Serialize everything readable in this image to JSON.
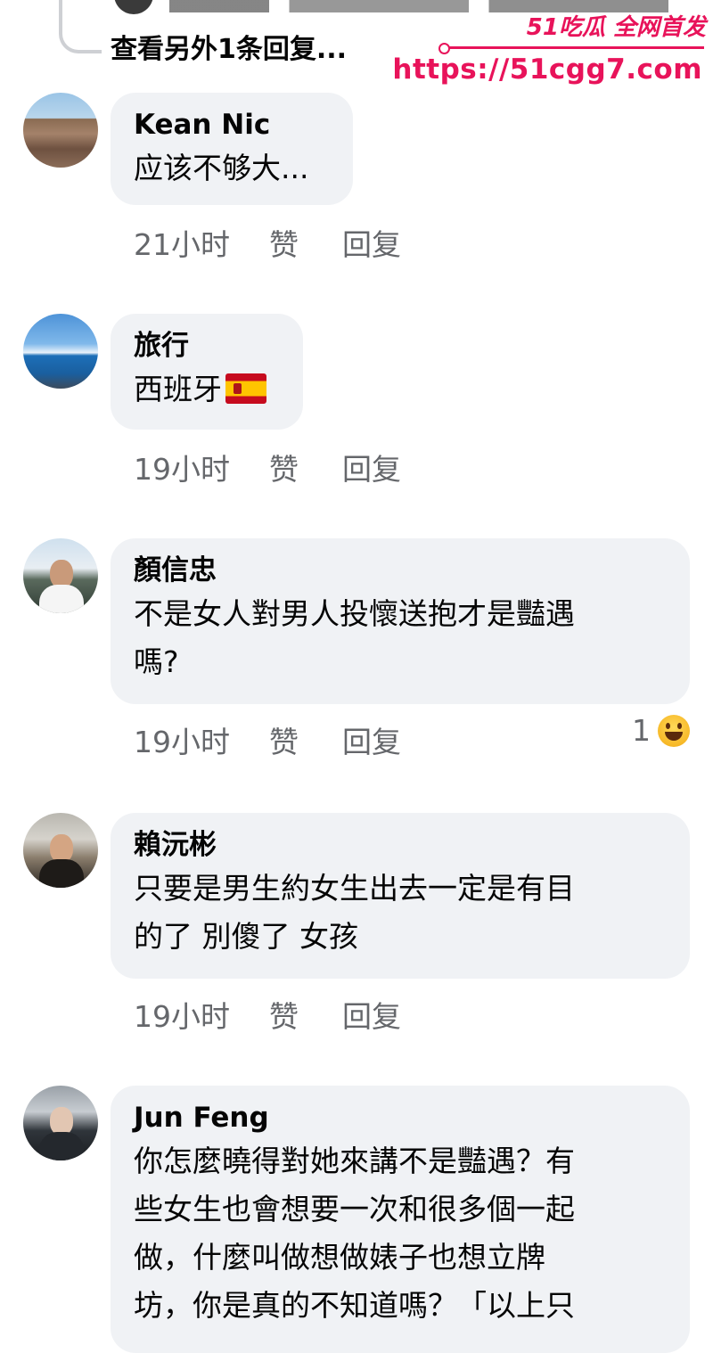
{
  "thread": {
    "view_more_replies": "查看另外1条回复..."
  },
  "watermark": {
    "brand": "51吃瓜 全网首发",
    "url": "https://51cgg7.com",
    "color": "#e8135a"
  },
  "actions": {
    "like": "赞",
    "reply": "回复"
  },
  "comments": [
    {
      "author": "Kean Nic",
      "text": "应该不够大...",
      "time": "21小时",
      "avatar_icon": "rocky-coast-avatar"
    },
    {
      "author": "旅行",
      "text": "西班牙",
      "text_emoji": "spain-flag-icon",
      "time": "19小时",
      "avatar_icon": "sea-view-avatar"
    },
    {
      "author": "顏信忠",
      "text_lines": [
        "不是女人對男人投懷送抱才是豔遇",
        "嗎?"
      ],
      "time": "19小时",
      "reaction_count": "1",
      "reaction_icon": "laughing-emoji-icon",
      "avatar_icon": "man-portrait-avatar"
    },
    {
      "author": "賴沅彬",
      "text_lines": [
        "只要是男生約女生出去一定是有目",
        "的了 別傻了 女孩"
      ],
      "time": "19小时",
      "avatar_icon": "man-selfie-avatar"
    },
    {
      "author": "Jun Feng",
      "text_lines": [
        "你怎麼曉得對她來講不是豔遇？有",
        "些女生也會想要一次和很多個一起",
        "做，什麼叫做想做婊子也想立牌",
        "坊，你是真的不知道嗎？「以上只"
      ],
      "time": "",
      "avatar_icon": "sunglasses-avatar"
    }
  ],
  "colors": {
    "bubble": "#f0f2f5",
    "meta_text": "#65676b",
    "primary_text": "#050505"
  }
}
